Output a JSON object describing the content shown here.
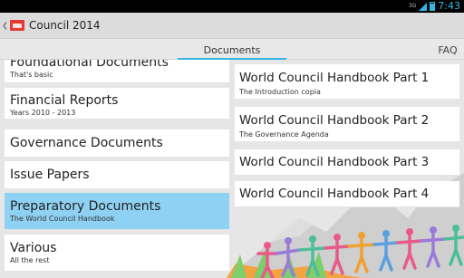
{
  "status_bar": {
    "time": "7:43",
    "network": "3G"
  },
  "app": {
    "title": "Council 2014"
  },
  "tabs": [
    {
      "label": "Documents",
      "selected": true
    },
    {
      "label": "FAQ",
      "selected": false
    }
  ],
  "categories": [
    {
      "title": "Foundational Documents",
      "subtitle": "That's basic",
      "selected": false
    },
    {
      "title": "Financial Reports",
      "subtitle": "Years 2010 - 2013",
      "selected": false
    },
    {
      "title": "Governance Documents",
      "subtitle": "",
      "selected": false
    },
    {
      "title": "Issue Papers",
      "subtitle": "",
      "selected": false
    },
    {
      "title": "Preparatory Documents",
      "subtitle": "The World Council Handbook",
      "selected": true
    },
    {
      "title": "Various",
      "subtitle": "All the rest",
      "selected": false
    }
  ],
  "documents": [
    {
      "title": "World Council Handbook Part 1",
      "subtitle": "The Introduction copia"
    },
    {
      "title": "World Council Handbook Part 2",
      "subtitle": "The Governance Agenda"
    },
    {
      "title": "World Council Handbook Part 3",
      "subtitle": ""
    },
    {
      "title": "World Council Handbook Part 4",
      "subtitle": ""
    }
  ],
  "colors": {
    "accent": "#33b5e5",
    "selected_row": "#8fd1f3",
    "logo": "#e53935"
  }
}
